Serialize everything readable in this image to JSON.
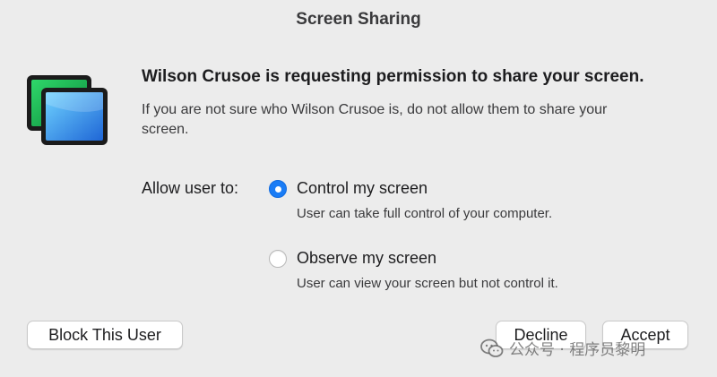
{
  "dialog": {
    "title": "Screen Sharing",
    "heading": "Wilson Crusoe is requesting permission to share your screen.",
    "subtext": "If you are not sure who Wilson Crusoe is, do not allow them to share your screen.",
    "icon": "screen-sharing-app-icon"
  },
  "permissions": {
    "label": "Allow user to:",
    "selected": "control",
    "options": [
      {
        "title": "Control my screen",
        "description": "User can take full control of your computer.",
        "selected": true
      },
      {
        "title": "Observe my screen",
        "description": "User can view your screen but not control it.",
        "selected": false
      }
    ]
  },
  "buttons": {
    "block": "Block This User",
    "decline": "Decline",
    "accept": "Accept"
  },
  "watermark": {
    "text": "公众号 · 程序员黎明",
    "icon": "wechat-icon"
  },
  "colors": {
    "accent": "#1a7cf5",
    "window_bg": "#ececec"
  }
}
